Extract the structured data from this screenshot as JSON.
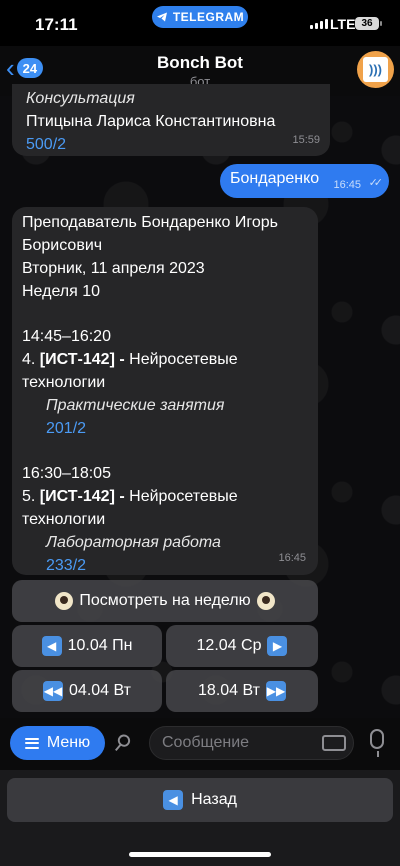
{
  "status": {
    "time": "17:11",
    "app_pill": "TELEGRAM",
    "network": "LTE",
    "battery": "36"
  },
  "header": {
    "back_count": "24",
    "title": "Bonch Bot",
    "subtitle": "бот"
  },
  "messages": {
    "prev": {
      "lines": [
        "Консультация",
        "Птицына Лариса Константиновна",
        "500/2"
      ],
      "time": "15:59"
    },
    "outgoing": {
      "text": "Бондаренко",
      "time": "16:45"
    },
    "schedule": {
      "teacher_line1": "Преподаватель Бондаренко Игорь",
      "teacher_line2": "Борисович",
      "date": "Вторник, 11 апреля 2023",
      "week": "Неделя 10",
      "lessons": [
        {
          "time": "14:45–16:20",
          "num": "4.",
          "group": "[ИСТ-142]",
          "dash": "-",
          "subject_part1": "Нейросетевые",
          "subject_part2": "технологии",
          "type": "Практические занятия",
          "room": "201/2"
        },
        {
          "time": "16:30–18:05",
          "num": "5.",
          "group": "[ИСТ-142]",
          "dash": "-",
          "subject_part1": "Нейросетевые",
          "subject_part2": "технологии",
          "type": "Лабораторная работа",
          "room": "233/2"
        }
      ],
      "time_sent": "16:45"
    }
  },
  "inline_keyboard": {
    "week_button": "Посмотреть на неделю",
    "prev_day": "10.04 Пн",
    "next_day": "12.04 Ср",
    "prev_week": "04.04 Вт",
    "next_week": "18.04 Вт"
  },
  "input": {
    "menu_label": "Меню",
    "placeholder": "Сообщение"
  },
  "reply_keyboard": {
    "back_label": "Назад"
  },
  "colors": {
    "accent": "#2f7bf0",
    "link": "#4b9bf5",
    "bubble": "#262628"
  }
}
